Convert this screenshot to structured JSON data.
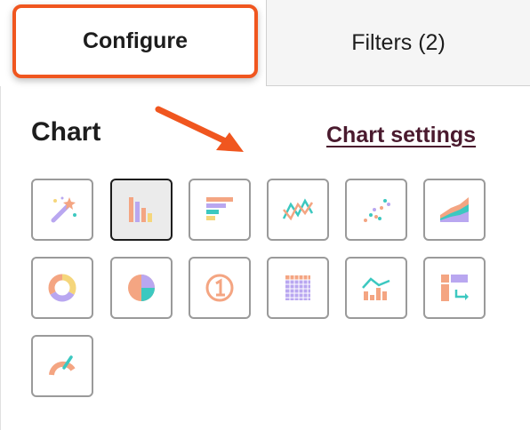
{
  "tabs": {
    "configure": "Configure",
    "filters": "Filters (2)"
  },
  "panel": {
    "title": "Chart",
    "settings_link": "Chart settings"
  },
  "chart_types": [
    {
      "icon": "magic-wand-icon",
      "selected": false
    },
    {
      "icon": "vertical-bar-chart-icon",
      "selected": true
    },
    {
      "icon": "horizontal-bar-chart-icon",
      "selected": false
    },
    {
      "icon": "line-chart-icon",
      "selected": false
    },
    {
      "icon": "scatter-chart-icon",
      "selected": false
    },
    {
      "icon": "area-chart-icon",
      "selected": false
    },
    {
      "icon": "donut-chart-icon",
      "selected": false
    },
    {
      "icon": "pie-chart-icon",
      "selected": false
    },
    {
      "icon": "single-value-icon",
      "selected": false
    },
    {
      "icon": "table-icon",
      "selected": false
    },
    {
      "icon": "combo-chart-icon",
      "selected": false
    },
    {
      "icon": "pivot-table-icon",
      "selected": false
    },
    {
      "icon": "gauge-icon",
      "selected": false
    }
  ],
  "colors": {
    "accent": "#f0561f",
    "link": "#4a1a2e",
    "orange": "#f4a582",
    "teal": "#3cc8c0",
    "purple": "#b9a7f0",
    "yellow": "#f5d67b"
  }
}
